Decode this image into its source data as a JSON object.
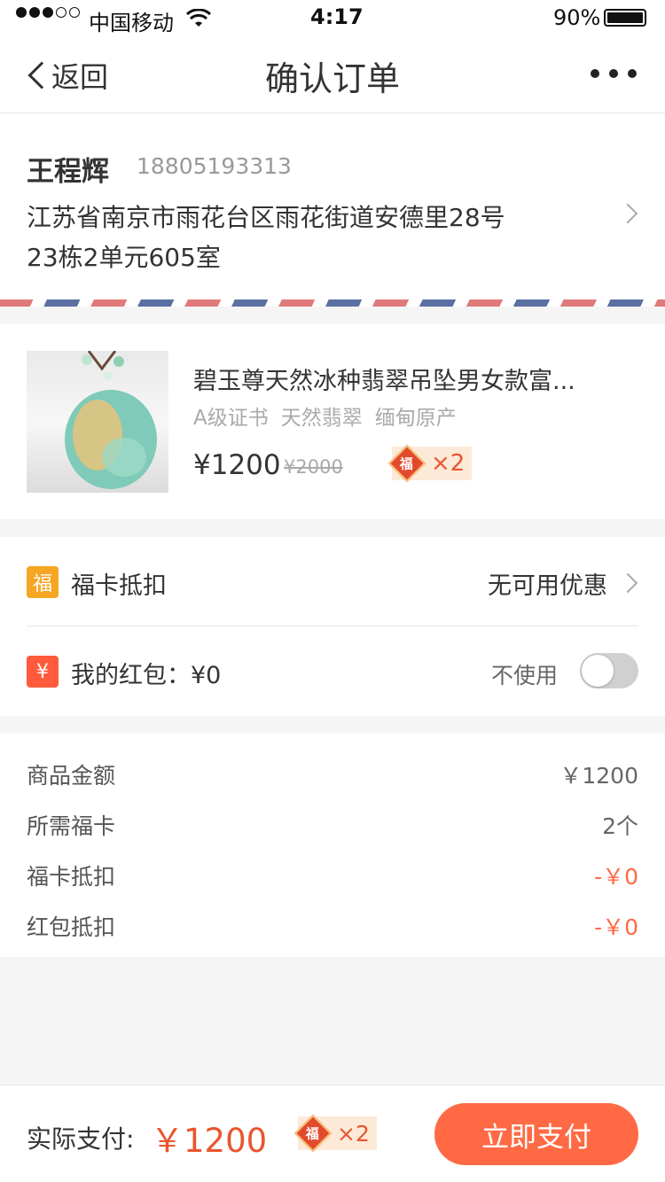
{
  "status_bar": {
    "carrier": "中国移动",
    "time": "4:17",
    "battery": "90%",
    "battery_level": 0.9
  },
  "nav": {
    "back_label": "返回",
    "title": "确认订单",
    "more_label": "•••"
  },
  "address": {
    "name": "王程辉",
    "phone": "18805193313",
    "line1": "江苏省南京市雨花台区雨花街道安德里28号",
    "line2": "23栋2单元605室"
  },
  "product": {
    "title": "碧玉尊天然冰种翡翠吊坠男女款富...",
    "tags": [
      "A级证书",
      "天然翡翠",
      "缅甸原产"
    ],
    "price": "¥1200",
    "original_price": "¥2000",
    "fu_char": "福",
    "fu_count": "×2"
  },
  "discount": {
    "fu_card": {
      "icon_char": "福",
      "label": "福卡抵扣",
      "value": "无可用优惠"
    },
    "red_packet": {
      "icon_char": "¥",
      "label": "我的红包：¥0",
      "toggle_label": "不使用",
      "toggle_on": false
    }
  },
  "summary": {
    "rows": [
      {
        "label": "商品金额",
        "value": "￥1200"
      },
      {
        "label": "所需福卡",
        "value": "2个"
      },
      {
        "label": "福卡抵扣",
        "value": "-￥0"
      },
      {
        "label": "红包抵扣",
        "value": "-￥0"
      }
    ]
  },
  "footer": {
    "pay_label": "实际支付:",
    "pay_amount": "￥1200",
    "fu_char": "福",
    "fu_count": "×2",
    "pay_button": "立即支付"
  },
  "colors": {
    "accent": "#ff6a45",
    "price_red": "#e9552f",
    "fu_orange": "#f5a623"
  }
}
